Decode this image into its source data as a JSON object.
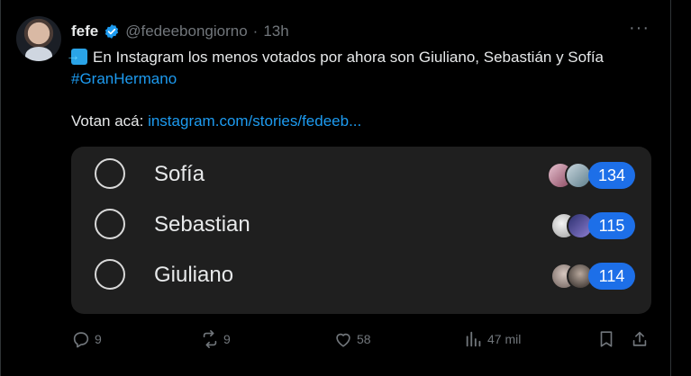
{
  "tweet": {
    "name": "fefe",
    "handle": "@fedeebongiorno",
    "separator": "·",
    "time": "13h",
    "more": "···",
    "text_main": "En Instagram los menos votados por ahora son Giuliano, Sebastián y Sofía",
    "hashtag": "#GranHermano",
    "votan_prefix": "Votan acá:",
    "link": "instagram.com/stories/fedeeb..."
  },
  "poll": {
    "options": [
      {
        "label": "Sofía",
        "count": "134"
      },
      {
        "label": "Sebastian",
        "count": "115"
      },
      {
        "label": "Giuliano",
        "count": "114"
      }
    ]
  },
  "actions": {
    "replies": "9",
    "retweets": "9",
    "likes": "58",
    "views": "47 mil"
  },
  "colors": {
    "accent": "#1d9bf0",
    "count_badge": "#1d6fe8",
    "poll_bg": "#1f1f1f",
    "muted": "#71767b"
  }
}
